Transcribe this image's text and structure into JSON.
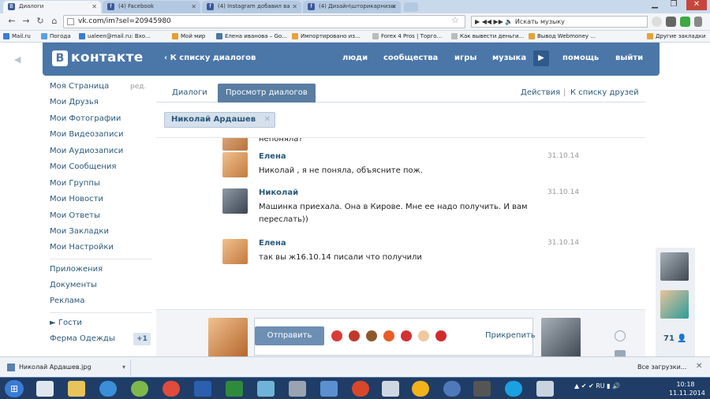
{
  "browser": {
    "tabs": [
      {
        "label": "Диалоги",
        "active": true
      },
      {
        "label": "(4) Facebook",
        "active": false
      },
      {
        "label": "(4) Instagram добавил ва",
        "active": false
      },
      {
        "label": "(4) Дизайн\\шторикарнизы",
        "active": false
      }
    ],
    "url": "vk.com/im?sel=20945980",
    "music_search_placeholder": "Искать музыку",
    "bookmarks": [
      "Mail.ru",
      "Погода",
      "ualeen@mail.ru: Вхо...",
      "Мой мир",
      "Елена иванова – Go...",
      "Импортировано из...",
      "Forex 4 Pros | Торго...",
      "Как вывести деньги...",
      "Вывод Webmoney ...",
      "Другие закладки"
    ]
  },
  "vk_header": {
    "logo_letter": "В",
    "logo_text": "контакте",
    "back_to_list": "К списку диалогов",
    "menu": [
      "люди",
      "сообщества",
      "игры",
      "музыка",
      "помощь",
      "выйти"
    ]
  },
  "left_menu": {
    "edit_label": "ред.",
    "items": [
      "Моя Страница",
      "Мои Друзья",
      "Мои Фотографии",
      "Мои Видеозаписи",
      "Мои Аудиозаписи",
      "Мои Сообщения",
      "Мои Группы",
      "Мои Новости",
      "Мои Ответы",
      "Мои Закладки",
      "Мои Настройки"
    ],
    "extra": [
      "Приложения",
      "Документы",
      "Реклама"
    ],
    "guests": "► Гости",
    "farm": "Ферма Одежды",
    "farm_counter": "+1"
  },
  "dialog": {
    "tab_dialogs": "Диалоги",
    "tab_view": "Просмотр диалогов",
    "actions": "Действия",
    "separator": "|",
    "friends_list": "К списку друзей",
    "chip_name": "Николай Ардашев",
    "partial_text": "непоняла?",
    "messages": [
      {
        "name": "Елена",
        "text": "Николай , я не поняла, объясните пож.",
        "date": "31.10.14"
      },
      {
        "name": "Николай",
        "text": "Машинка приехала. Она в Кирове. Мне ее надо получить. И вам переслать))",
        "date": "31.10.14"
      },
      {
        "name": "Елена",
        "text": "так вы ж16.10.14 писали что получили",
        "date": "31.10.14"
      }
    ],
    "send_label": "Отправить",
    "attach_label": "Прикрепить"
  },
  "right_panel": {
    "count": "71"
  },
  "download_bar": {
    "file": "Николай Ардашев.jpg",
    "all": "Все загрузки..."
  },
  "taskbar": {
    "lang": "RU",
    "time": "10:18",
    "date": "11.11.2014"
  },
  "colors": {
    "vk_blue": "#4a76a8",
    "link": "#2b587a"
  }
}
